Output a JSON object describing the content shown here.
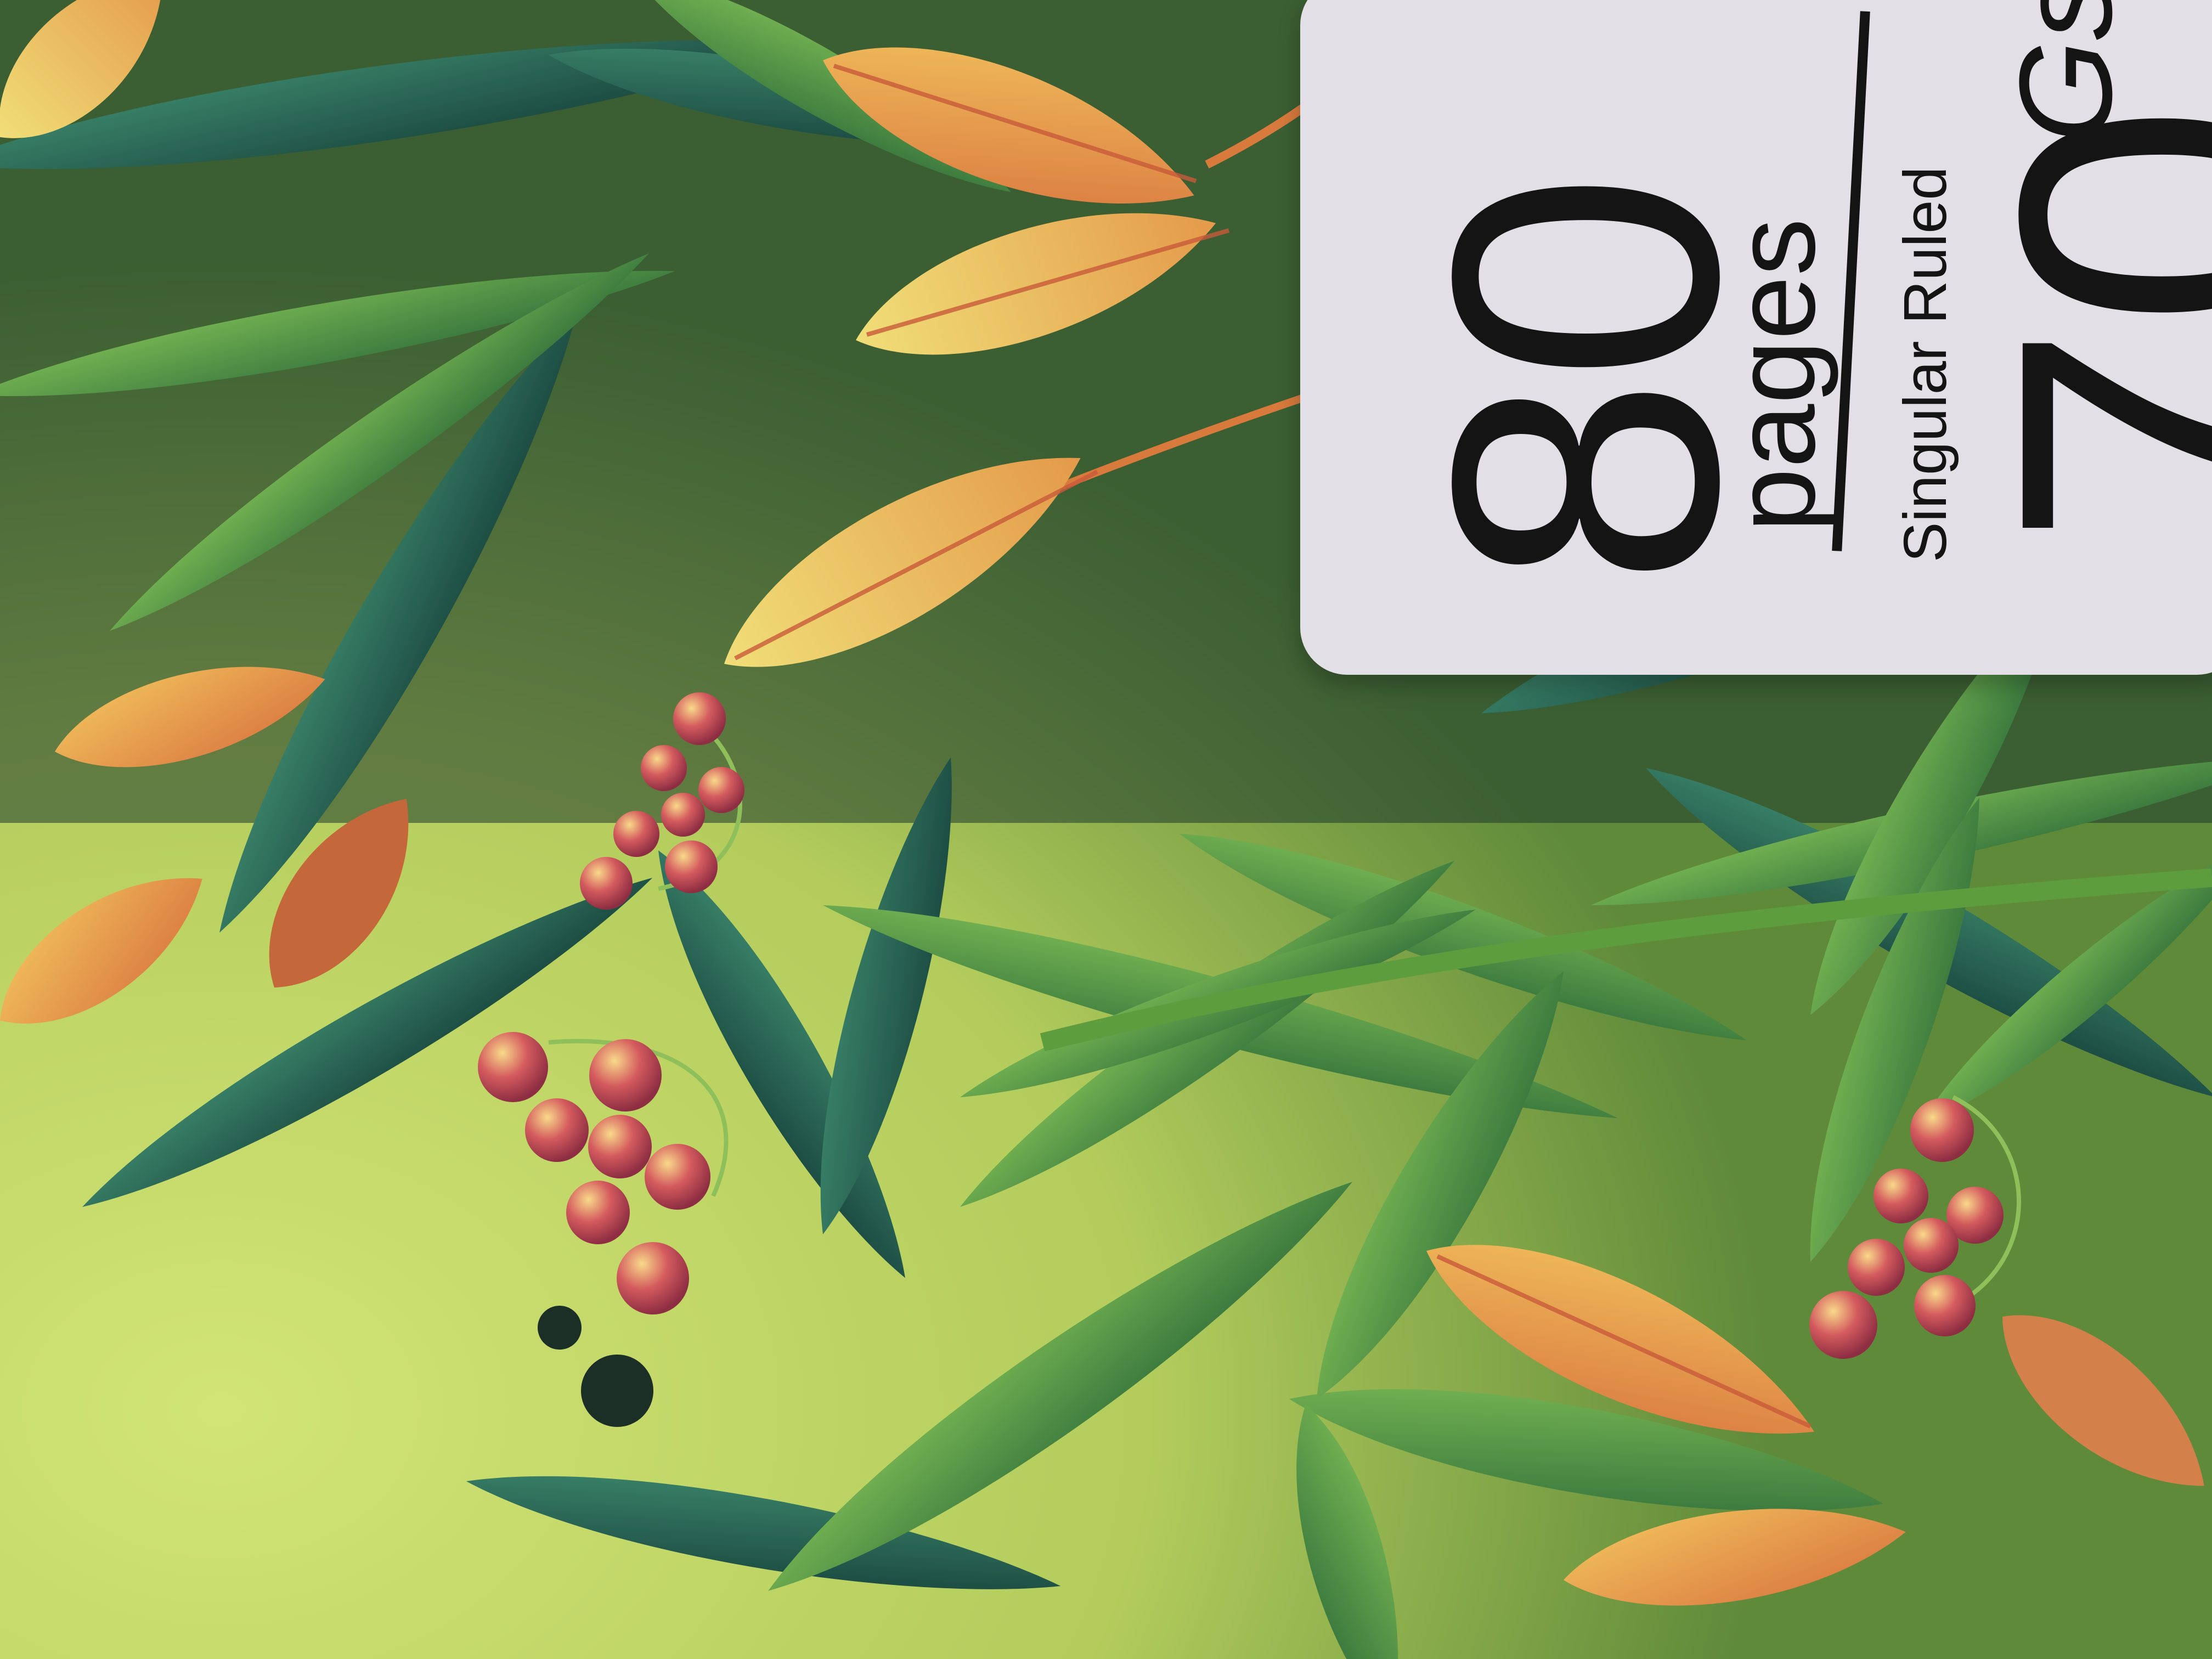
{
  "notebook_cover": {
    "page_count": "80",
    "page_unit": "pages",
    "ruling": "Singular Ruled",
    "paper_weight": "70",
    "paper_weight_unit": "Gsm"
  },
  "artwork": {
    "subject": "leaves-and-berries-illustration",
    "colors": {
      "background_lime": "#c8dc6a",
      "deep_teal": "#1f4a3c",
      "leaf_green": "#4f8f3e",
      "leaf_orange": "#e89a4c",
      "leaf_yellow": "#e7c35a",
      "berry_red": "#c9485a",
      "label_white": "#e2e0e6"
    }
  }
}
